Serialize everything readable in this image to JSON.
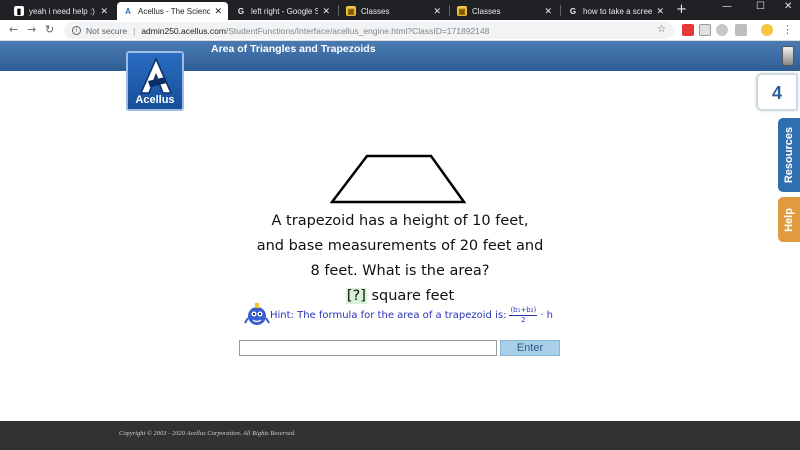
{
  "browser": {
    "tabs": [
      {
        "label": "yeah i need help :) .......",
        "icon": "bookmark-icon",
        "color": "#ffffff"
      },
      {
        "label": "Acellus - The Science of",
        "icon": "acellus-icon",
        "color": "#2a6cc0"
      },
      {
        "label": "left right - Google Search",
        "icon": "google-icon",
        "color": "#e8eaed"
      },
      {
        "label": "Classes",
        "icon": "classes-icon",
        "color": "#f4c542"
      },
      {
        "label": "Classes",
        "icon": "classes-icon",
        "color": "#f4c542"
      },
      {
        "label": "how to take a screen sh",
        "icon": "google-icon",
        "color": "#e8eaed"
      }
    ],
    "new_tab": "+",
    "window_controls": [
      "—",
      "☐",
      "✕"
    ],
    "address": {
      "security": "Not secure",
      "host": "admin250.acellus.com",
      "path": "/StudentFunctions/Interface/acellus_engine.html?ClassID=171892148"
    }
  },
  "header": {
    "title": "Area of Triangles and Trapezoids",
    "logo_text": "Acellus"
  },
  "side": {
    "number": "4",
    "resources": "Resources",
    "help": "Help"
  },
  "question": {
    "line1": "A trapezoid has a height of 10 feet,",
    "line2": "and base measurements of 20 feet and",
    "line3": "8 feet. What is the area?",
    "blank": "[?]",
    "unit": "square feet"
  },
  "hint": {
    "label": "Hint",
    "text": ": The formula for the area of a trapezoid is:",
    "frac_num": "(b₁+b₂)",
    "frac_den": "2",
    "tail": "· h"
  },
  "answer": {
    "value": "",
    "enter_label": "Enter"
  },
  "footer": {
    "copyright": "Copyright © 2003 - 2020 Acellus Corporation.  All Rights Reserved."
  },
  "colors": {
    "band": "#3a6ca6",
    "hint_text": "#2934b5",
    "enter_button": "#a9cfe9",
    "resources_tab": "#2f6faf",
    "help_tab": "#e19a3e"
  }
}
